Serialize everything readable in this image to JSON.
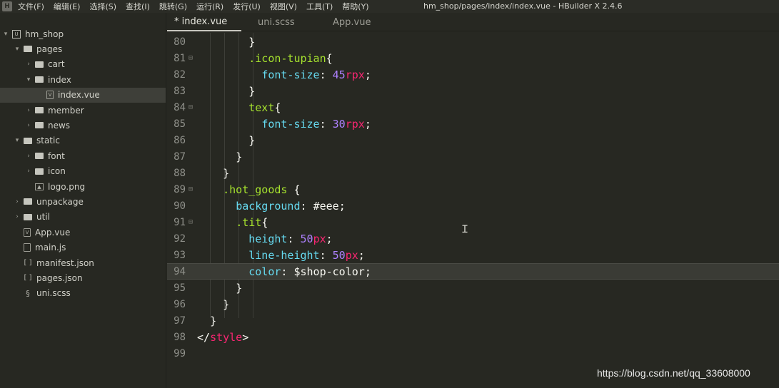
{
  "menubar": {
    "items": [
      "文件(F)",
      "编辑(E)",
      "选择(S)",
      "查找(I)",
      "跳转(G)",
      "运行(R)",
      "发行(U)",
      "视图(V)",
      "工具(T)",
      "帮助(Y)"
    ],
    "title": "hm_shop/pages/index/index.vue - HBuilder X 2.4.6"
  },
  "sidebar": {
    "items": [
      {
        "label": "hm_shop",
        "type": "project",
        "expanded": true
      },
      {
        "label": "pages",
        "type": "folder",
        "expanded": true
      },
      {
        "label": "cart",
        "type": "folder",
        "expanded": false
      },
      {
        "label": "index",
        "type": "folder",
        "expanded": true
      },
      {
        "label": "index.vue",
        "type": "vue-file",
        "selected": true
      },
      {
        "label": "member",
        "type": "folder",
        "expanded": false
      },
      {
        "label": "news",
        "type": "folder",
        "expanded": false
      },
      {
        "label": "static",
        "type": "folder",
        "expanded": true
      },
      {
        "label": "font",
        "type": "folder",
        "expanded": false
      },
      {
        "label": "icon",
        "type": "folder",
        "expanded": false
      },
      {
        "label": "logo.png",
        "type": "image-file"
      },
      {
        "label": "unpackage",
        "type": "folder",
        "expanded": false
      },
      {
        "label": "util",
        "type": "folder",
        "expanded": false
      },
      {
        "label": "App.vue",
        "type": "vue-file"
      },
      {
        "label": "main.js",
        "type": "js-file"
      },
      {
        "label": "manifest.json",
        "type": "json-file"
      },
      {
        "label": "pages.json",
        "type": "json-file"
      },
      {
        "label": "uni.scss",
        "type": "scss-file"
      }
    ]
  },
  "tabs": [
    {
      "label": "* index.vue",
      "active": true
    },
    {
      "label": "uni.scss",
      "active": false
    },
    {
      "label": "App.vue",
      "active": false
    }
  ],
  "editor": {
    "current_line": 94,
    "lines": [
      {
        "n": "80",
        "fold": false,
        "tokens": [
          [
            "        ",
            ""
          ],
          [
            "}",
            "t-punc"
          ]
        ]
      },
      {
        "n": "81",
        "fold": true,
        "tokens": [
          [
            "        ",
            ""
          ],
          [
            ".icon-tupian",
            "t-sel"
          ],
          [
            "{",
            "t-punc"
          ]
        ]
      },
      {
        "n": "82",
        "fold": false,
        "tokens": [
          [
            "          ",
            ""
          ],
          [
            "font-size",
            "t-prop"
          ],
          [
            ": ",
            "t-punc"
          ],
          [
            "45",
            "t-num"
          ],
          [
            "rpx",
            "t-unit"
          ],
          [
            ";",
            "t-punc"
          ]
        ]
      },
      {
        "n": "83",
        "fold": false,
        "tokens": [
          [
            "        ",
            ""
          ],
          [
            "}",
            "t-punc"
          ]
        ]
      },
      {
        "n": "84",
        "fold": true,
        "tokens": [
          [
            "        ",
            ""
          ],
          [
            "text",
            "t-sel"
          ],
          [
            "{",
            "t-punc"
          ]
        ]
      },
      {
        "n": "85",
        "fold": false,
        "tokens": [
          [
            "          ",
            ""
          ],
          [
            "font-size",
            "t-prop"
          ],
          [
            ": ",
            "t-punc"
          ],
          [
            "30",
            "t-num"
          ],
          [
            "rpx",
            "t-unit"
          ],
          [
            ";",
            "t-punc"
          ]
        ]
      },
      {
        "n": "86",
        "fold": false,
        "tokens": [
          [
            "        ",
            ""
          ],
          [
            "}",
            "t-punc"
          ]
        ]
      },
      {
        "n": "87",
        "fold": false,
        "tokens": [
          [
            "      ",
            ""
          ],
          [
            "}",
            "t-punc"
          ]
        ]
      },
      {
        "n": "88",
        "fold": false,
        "tokens": [
          [
            "    ",
            ""
          ],
          [
            "}",
            "t-punc"
          ]
        ]
      },
      {
        "n": "89",
        "fold": true,
        "tokens": [
          [
            "    ",
            ""
          ],
          [
            ".hot_goods",
            "t-sel"
          ],
          [
            " {",
            "t-punc"
          ]
        ]
      },
      {
        "n": "90",
        "fold": false,
        "tokens": [
          [
            "      ",
            ""
          ],
          [
            "background",
            "t-prop"
          ],
          [
            ": ",
            "t-punc"
          ],
          [
            "#eee",
            "t-val"
          ],
          [
            ";",
            "t-punc"
          ]
        ]
      },
      {
        "n": "91",
        "fold": true,
        "tokens": [
          [
            "      ",
            ""
          ],
          [
            ".tit",
            "t-sel"
          ],
          [
            "{",
            "t-punc"
          ]
        ]
      },
      {
        "n": "92",
        "fold": false,
        "tokens": [
          [
            "        ",
            ""
          ],
          [
            "height",
            "t-prop"
          ],
          [
            ": ",
            "t-punc"
          ],
          [
            "50",
            "t-num"
          ],
          [
            "px",
            "t-unit"
          ],
          [
            ";",
            "t-punc"
          ]
        ]
      },
      {
        "n": "93",
        "fold": false,
        "tokens": [
          [
            "        ",
            ""
          ],
          [
            "line-height",
            "t-prop"
          ],
          [
            ": ",
            "t-punc"
          ],
          [
            "50",
            "t-num"
          ],
          [
            "px",
            "t-unit"
          ],
          [
            ";",
            "t-punc"
          ]
        ]
      },
      {
        "n": "94",
        "fold": false,
        "tokens": [
          [
            "        ",
            ""
          ],
          [
            "color",
            "t-prop"
          ],
          [
            ": ",
            "t-punc"
          ],
          [
            "$shop-color",
            "t-val"
          ],
          [
            ";",
            "t-punc"
          ]
        ]
      },
      {
        "n": "95",
        "fold": false,
        "tokens": [
          [
            "      ",
            ""
          ],
          [
            "}",
            "t-punc"
          ]
        ]
      },
      {
        "n": "96",
        "fold": false,
        "tokens": [
          [
            "    ",
            ""
          ],
          [
            "}",
            "t-punc"
          ]
        ]
      },
      {
        "n": "97",
        "fold": false,
        "tokens": [
          [
            "  ",
            ""
          ],
          [
            "}",
            "t-punc"
          ]
        ]
      },
      {
        "n": "98",
        "fold": false,
        "tokens": [
          [
            "</",
            "t-punc"
          ],
          [
            "style",
            "t-tag"
          ],
          [
            ">",
            "t-punc"
          ]
        ]
      },
      {
        "n": "99",
        "fold": false,
        "tokens": []
      }
    ]
  },
  "watermark": "https://blog.csdn.net/qq_33608000"
}
